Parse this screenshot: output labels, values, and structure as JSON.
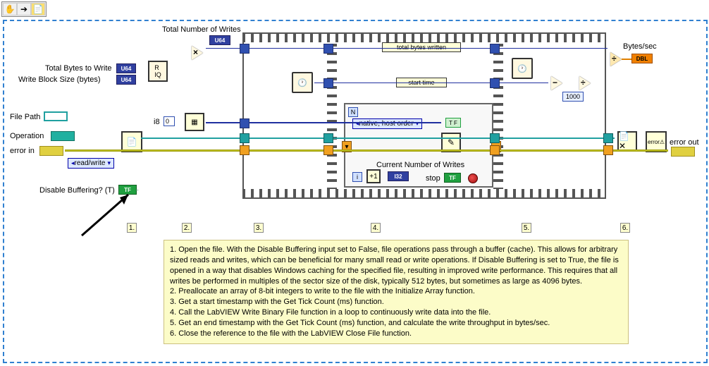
{
  "toolbar": {
    "pan": "✋",
    "arrow": "➔",
    "probe": "📄"
  },
  "labels": {
    "total_writes": "Total Number of Writes",
    "total_bytes": "Total Bytes to Write",
    "block_size": "Write Block Size (bytes)",
    "file_path": "File Path",
    "operation": "Operation",
    "error_in": "error in",
    "disable_buf": "Disable Buffering? (T)",
    "read_write": "read/write",
    "i8": "i8",
    "zero": "0",
    "total_bytes_written": "total bytes written",
    "start_time": "start time",
    "native": "native, host order",
    "current_writes": "Current Number of Writes",
    "stop": "stop",
    "bytes_sec": "Bytes/sec",
    "thousand": "1000",
    "error_out": "error out"
  },
  "type_tags": {
    "u64": "U64",
    "dbl": "DBL",
    "i32": "I32",
    "tf": "TF"
  },
  "seq_nums": {
    "n1": "1.",
    "n2": "2.",
    "n3": "3.",
    "n4": "4.",
    "n5": "5.",
    "n6": "6."
  },
  "notes": {
    "l1": "1. Open the file.  With the Disable Buffering input set to False, file operations pass through a buffer (cache). This allows for arbitrary sized reads and writes, which can be beneficial for many small read or write operations.  If Disable Buffering is set to True, the file is opened in a way that disables Windows caching for the specified file, resulting in improved write performance.  This requires that all writes be performed in multiples of the sector size of the disk, typically 512 bytes, but sometimes as large as 4096 bytes.",
    "l2": "2. Preallocate an array of 8-bit integers to write to the file with the Initialize Array function.",
    "l3": "3. Get a start timestamp with the Get Tick Count (ms) function.",
    "l4": "4. Call the LabVIEW Write Binary File function in a loop to continuously write data into the file.",
    "l5": "5. Get an end timestamp with the Get Tick Count (ms) function, and calculate the write throughput in bytes/sec.",
    "l6": "6. Close the reference to the file with the LabVIEW Close File function."
  },
  "chart_data": {
    "type": "diagram",
    "description": "LabVIEW block diagram showing file write benchmarking with sequence structure (frames 1-6) containing file open, array init, tick count, while-loop binary write, throughput calc, file close."
  }
}
